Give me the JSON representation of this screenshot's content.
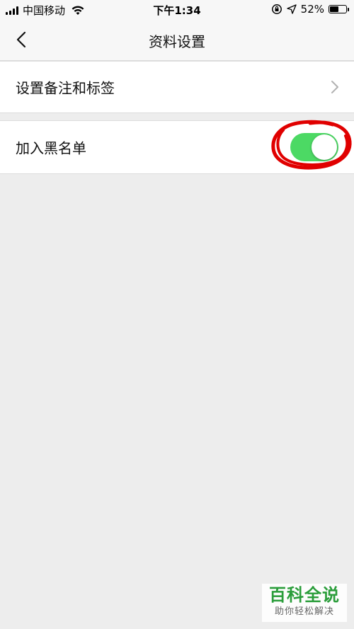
{
  "status_bar": {
    "carrier": "中国移动",
    "time": "下午1:34",
    "battery_percent": "52%",
    "battery_level": 0.52,
    "icons": [
      "signal-icon",
      "wifi-icon",
      "orientation-lock-icon",
      "location-icon",
      "battery-icon"
    ]
  },
  "nav": {
    "title": "资料设置",
    "back_icon": "chevron-left-icon"
  },
  "settings": {
    "remark_label": "设置备注和标签",
    "blacklist_label": "加入黑名单",
    "blacklist_enabled": true
  },
  "colors": {
    "toggle_on": "#4cd964",
    "annotation": "#e00000",
    "background": "#ededed",
    "watermark_green": "#2a9d3a"
  },
  "watermark": {
    "main": "百科全说",
    "sub": "助你轻松解决"
  }
}
